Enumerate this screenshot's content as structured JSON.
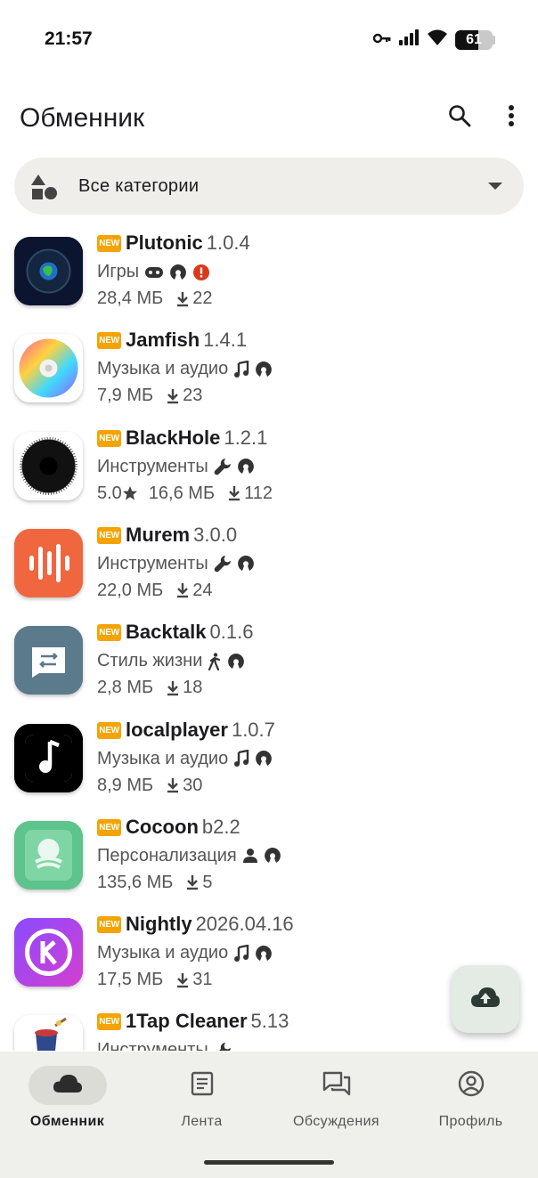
{
  "status_bar": {
    "time": "21:57",
    "battery_percent": "61",
    "battery_level": 0.61,
    "icons": [
      "key-icon",
      "signal-icon",
      "wifi-icon",
      "battery-icon"
    ]
  },
  "app_bar": {
    "title": "Обменник",
    "icons": [
      "search-icon",
      "more-vert-icon"
    ]
  },
  "category_filter": {
    "label": "Все категории",
    "icon": "category-shapes-icon"
  },
  "new_badge": "NEW",
  "apps": [
    {
      "name": "Plutonic",
      "version": "1.0.4",
      "category": "Игры",
      "category_icon": "gamepad-icon",
      "extra_icons": [
        "opensource-icon",
        "warning-icon"
      ],
      "rating": "",
      "size": "28,4 МБ",
      "downloads": "22",
      "icon_color": "#0b1530"
    },
    {
      "name": "Jamfish",
      "version": "1.4.1",
      "category": "Музыка и аудио",
      "category_icon": "music-note-icon",
      "extra_icons": [
        "opensource-icon"
      ],
      "rating": "",
      "size": "7,9 МБ",
      "downloads": "23",
      "icon_color": "#ffffff"
    },
    {
      "name": "BlackHole",
      "version": "1.2.1",
      "category": "Инструменты",
      "category_icon": "wrench-icon",
      "extra_icons": [
        "opensource-icon"
      ],
      "rating": "5.0",
      "size": "16,6 МБ",
      "downloads": "112",
      "icon_color": "#ffffff"
    },
    {
      "name": "Murem",
      "version": "3.0.0",
      "category": "Инструменты",
      "category_icon": "wrench-icon",
      "extra_icons": [
        "opensource-icon"
      ],
      "rating": "",
      "size": "22,0 МБ",
      "downloads": "24",
      "icon_color": "#f0673f"
    },
    {
      "name": "Backtalk",
      "version": "0.1.6",
      "category": "Стиль жизни",
      "category_icon": "walking-icon",
      "extra_icons": [
        "opensource-icon"
      ],
      "rating": "",
      "size": "2,8 МБ",
      "downloads": "18",
      "icon_color": "#5b7a8c"
    },
    {
      "name": "localplayer",
      "version": "1.0.7",
      "category": "Музыка и аудио",
      "category_icon": "music-note-icon",
      "extra_icons": [
        "opensource-icon"
      ],
      "rating": "",
      "size": "8,9 МБ",
      "downloads": "30",
      "icon_color": "#000000"
    },
    {
      "name": "Cocoon",
      "version": "b2.2",
      "category": "Персонализация",
      "category_icon": "person-icon",
      "extra_icons": [
        "opensource-icon"
      ],
      "rating": "",
      "size": "135,6 МБ",
      "downloads": "5",
      "icon_color": "#5cc48c"
    },
    {
      "name": "Nightly",
      "version": "2026.04.16",
      "category": "Музыка и аудио",
      "category_icon": "music-note-icon",
      "extra_icons": [
        "opensource-icon"
      ],
      "rating": "",
      "size": "17,5 МБ",
      "downloads": "31",
      "icon_color": "#7b3ff2"
    },
    {
      "name": "1Tap Cleaner",
      "version": "5.13",
      "category": "Инструменты",
      "category_icon": "wrench-icon",
      "extra_icons": [],
      "rating": "",
      "size": "",
      "downloads": "",
      "icon_color": "#ffffff"
    }
  ],
  "fab": {
    "icon": "cloud-upload-icon"
  },
  "bottom_nav": [
    {
      "label": "Обменник",
      "icon": "cloud-icon",
      "active": true
    },
    {
      "label": "Лента",
      "icon": "feed-icon",
      "active": false
    },
    {
      "label": "Обсуждения",
      "icon": "forum-icon",
      "active": false
    },
    {
      "label": "Профиль",
      "icon": "account-circle-icon",
      "active": false
    }
  ]
}
